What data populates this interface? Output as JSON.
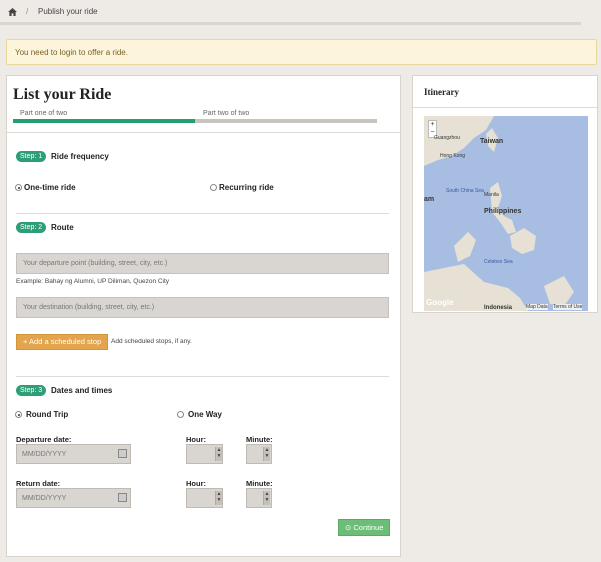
{
  "breadcrumb": {
    "separator": "/",
    "current": "Publish your ride"
  },
  "alert": {
    "message": "You need to login to offer a ride."
  },
  "form": {
    "title": "List your Ride",
    "part_one": "Part one of two",
    "part_two": "Part two of two",
    "progress": 0.5,
    "step1": {
      "badge": "Step: 1",
      "title": "Ride frequency",
      "one_time": "One-time ride",
      "recurring": "Recurring ride"
    },
    "step2": {
      "badge": "Step: 2",
      "title": "Route",
      "departure_placeholder": "Your departure point (building, street, city, etc.)",
      "example": "Example: Bahay ng Alumni, UP Diliman, Quezon City",
      "destination_placeholder": "Your destination (building, street, city, etc.)",
      "add_stop_button": "+ Add a scheduled stop",
      "add_stop_hint": "Add scheduled stops, if any."
    },
    "step3": {
      "badge": "Step: 3",
      "title": "Dates and times",
      "round_trip": "Round Trip",
      "one_way": "One Way",
      "departure_label": "Departure date:",
      "return_label": "Return date:",
      "hour_label": "Hour:",
      "minute_label": "Minute:",
      "date_placeholder": "MM/DD/YYYY"
    },
    "continue_button": "Continue"
  },
  "itinerary": {
    "title": "Itinerary",
    "zoom_in": "+",
    "zoom_out": "−",
    "labels": {
      "guangzhou": "Guangzhou",
      "taiwan": "Taiwan",
      "hongkong": "Hong Kong",
      "south_china_sea": "South China Sea",
      "manila": "Manila",
      "philippines": "Philippines",
      "celebes": "Celebes Sea",
      "am": "am",
      "indonesia": "Indonesia"
    },
    "logo": "Google",
    "map_data": "Map Data",
    "terms": "Terms of Use"
  }
}
